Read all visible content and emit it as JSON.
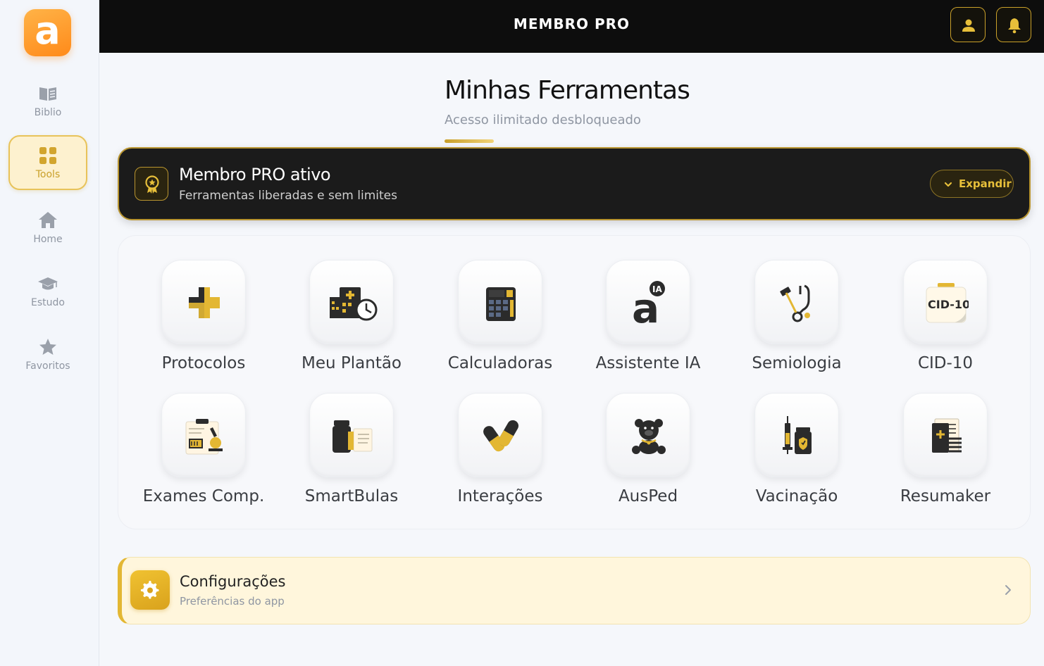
{
  "brand": {
    "logo_letter": "a",
    "accent": "#c9a02a",
    "orange": "#ff8a1a"
  },
  "sidebar": {
    "items": [
      {
        "label": "Biblio",
        "icon": "book-icon",
        "active": false
      },
      {
        "label": "Tools",
        "icon": "grid-icon",
        "active": true
      },
      {
        "label": "Home",
        "icon": "home-icon",
        "active": false
      },
      {
        "label": "Estudo",
        "icon": "graduation-cap-icon",
        "active": false
      },
      {
        "label": "Favoritos",
        "icon": "star-icon",
        "active": false
      }
    ]
  },
  "topbar": {
    "title": "MEMBRO PRO",
    "profile_icon": "user-icon",
    "notifications_icon": "bell-icon"
  },
  "heading": {
    "title": "Minhas Ferramentas",
    "subtitle": "Acesso ilimitado desbloqueado"
  },
  "pro_banner": {
    "title": "Membro PRO ativo",
    "subtitle": "Ferramentas liberadas e sem limites",
    "expand_label": "Expandir",
    "icon": "award-badge-icon"
  },
  "tools": [
    {
      "label": "Protocolos",
      "icon": "medical-cross-icon"
    },
    {
      "label": "Meu Plantão",
      "icon": "hospital-clock-icon"
    },
    {
      "label": "Calculadoras",
      "icon": "calculator-icon"
    },
    {
      "label": "Assistente IA",
      "icon": "ai-assistant-icon",
      "badge": "IA"
    },
    {
      "label": "Semiologia",
      "icon": "stethoscope-icon"
    },
    {
      "label": "CID-10",
      "icon": "cid-clipboard-icon",
      "badge": "CID-10"
    },
    {
      "label": "Exames Comp.",
      "icon": "lab-clipboard-icon"
    },
    {
      "label": "SmartBulas",
      "icon": "medicine-bottle-icon"
    },
    {
      "label": "Interações",
      "icon": "capsules-icon"
    },
    {
      "label": "AusPed",
      "icon": "teddy-bear-icon"
    },
    {
      "label": "Vacinação",
      "icon": "syringe-vial-icon"
    },
    {
      "label": "Resumaker",
      "icon": "notebook-icon"
    }
  ],
  "config": {
    "title": "Configurações",
    "subtitle": "Preferências do app",
    "icon": "gear-icon"
  }
}
